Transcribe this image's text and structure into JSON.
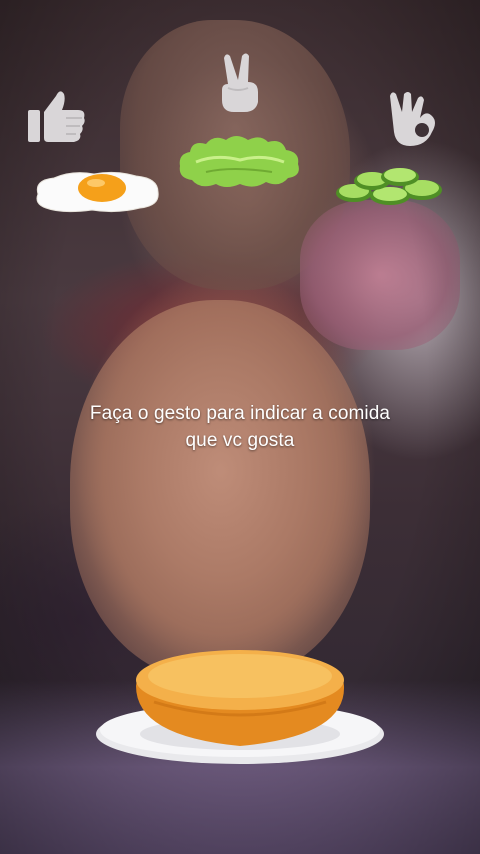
{
  "screen": {
    "instruction_line1": "Faça o gesto para indicar a comida",
    "instruction_line2": "que vc gosta"
  },
  "gestures": [
    {
      "icon": "thumbs-up-icon",
      "food": "fried-egg"
    },
    {
      "icon": "peace-sign-icon",
      "food": "lettuce"
    },
    {
      "icon": "ok-sign-icon",
      "food": "cucumber-slices"
    }
  ],
  "burger_base": {
    "icon": "burger-bun-plate-icon"
  },
  "colors": {
    "gesture_icon": "#d9d6d8",
    "text": "#ffffff",
    "egg_yolk": "#f5a01a",
    "lettuce": "#8fd14a",
    "cucumber": "#7dc243",
    "bun": "#f0a63a",
    "plate": "#f2f2f2"
  }
}
